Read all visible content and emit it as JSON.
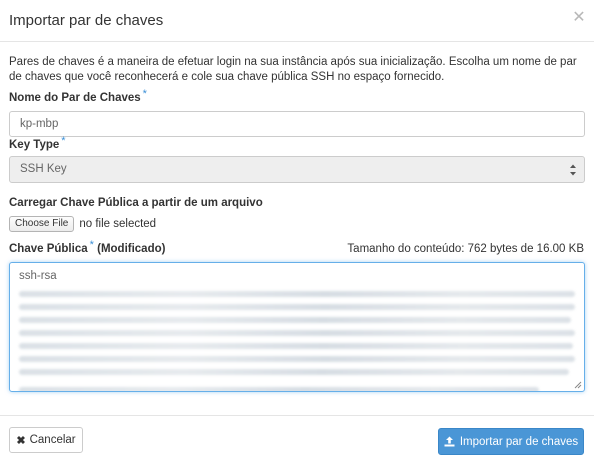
{
  "modal": {
    "title": "Importar par de chaves",
    "close_icon": "close-icon",
    "description": "Pares de chaves é a maneira de efetuar login na sua instância após sua inicialização. Escolha um nome de par de chaves que você reconhecerá e cole sua chave pública SSH no espaço fornecido."
  },
  "form": {
    "keypair_name": {
      "label": "Nome do Par de Chaves",
      "required_marker": "*",
      "value": "kp-mbp"
    },
    "key_type": {
      "label": "Key Type",
      "required_marker": "*",
      "selected": "SSH Key"
    },
    "file_upload": {
      "label": "Carregar Chave Pública a partir de um arquivo",
      "button_label": "Choose File",
      "status": "no file selected"
    },
    "public_key": {
      "label": "Chave Pública",
      "required_marker": "*",
      "modified_note": "(Modificado)",
      "size_info": "Tamanho do conteúdo: 762 bytes de 16.00 KB",
      "first_line": "ssh-rsa"
    }
  },
  "footer": {
    "cancel_label": "Cancelar",
    "submit_label": "Importar par de chaves",
    "submit_icon": "upload-icon"
  },
  "colors": {
    "accent": "#4a96d6",
    "required": "#3b8fd6",
    "focus_border": "#66afe9"
  }
}
